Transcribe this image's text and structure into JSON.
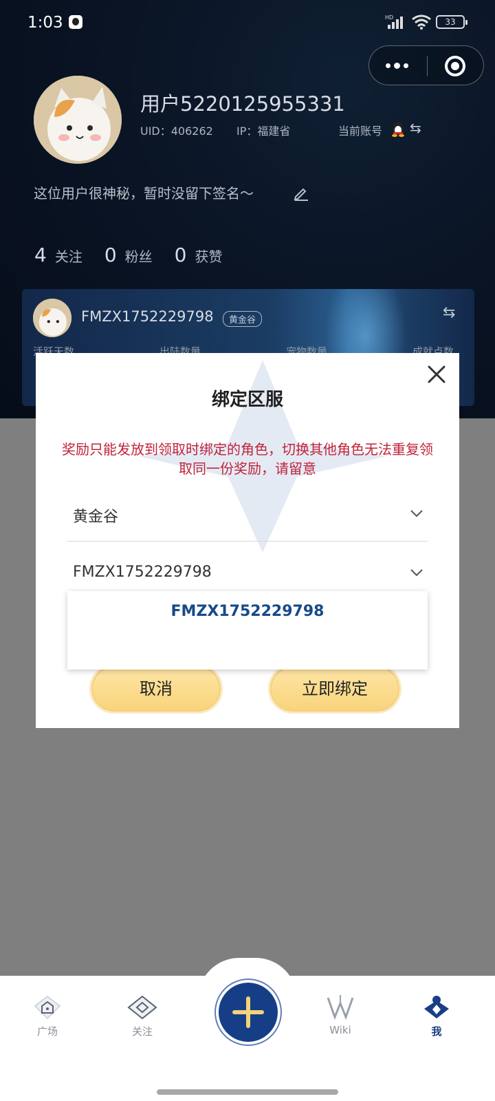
{
  "status_bar": {
    "time": "1:03",
    "battery": "33"
  },
  "profile": {
    "username": "用户5220125955331",
    "uid": "UID：406262",
    "ip": "IP：福建省",
    "current_account": "当前账号",
    "signature": "这位用户很神秘，暂时没留下签名～",
    "stats": [
      {
        "num": "4",
        "label": "关注"
      },
      {
        "num": "0",
        "label": "粉丝"
      },
      {
        "num": "0",
        "label": "获赞"
      }
    ]
  },
  "role_card": {
    "name": "FMZX1752229798",
    "server_tag": "黄金谷",
    "stats": [
      "活跃天数",
      "出陆数量",
      "宠物数量",
      "成就点数"
    ]
  },
  "modal": {
    "title": "绑定区服",
    "notice": "奖励只能发放到领取时绑定的角色，切换其他角色无法重复领取同一份奖励，请留意",
    "server_select": "黄金谷",
    "role_select": "FMZX1752229798",
    "dropdown_options": [
      "FMZX1752229798"
    ],
    "cancel_label": "取消",
    "confirm_label": "立即绑定"
  },
  "bottom_nav": {
    "items": [
      {
        "label": "广场"
      },
      {
        "label": "关注"
      },
      {
        "label": "Wiki"
      },
      {
        "label": "我"
      }
    ]
  },
  "colors": {
    "notice_red": "#c0233a",
    "option_blue": "#174a8a",
    "button_gold": "#f8d37a",
    "nav_active": "#1a3f86"
  }
}
